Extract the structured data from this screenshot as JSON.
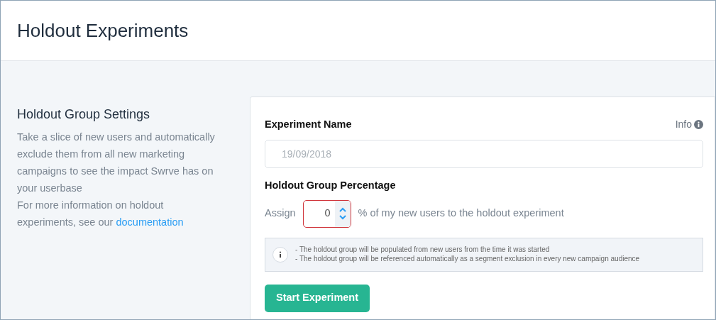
{
  "page": {
    "title": "Holdout Experiments"
  },
  "settings": {
    "heading": "Holdout Group Settings",
    "description": "Take a slice of new users and automatically exclude them from all new marketing campaigns to see the impact Swrve has on your userbase",
    "more_info": "For more information on holdout experiments, see our",
    "link": "documentation"
  },
  "form": {
    "name_label": "Experiment Name",
    "info_link": "Info",
    "name_field": {
      "placeholder": "19/09/2018"
    },
    "percentage_label": "Holdout Group Percentage",
    "assign_prefix": "Assign",
    "percentage_field": {
      "value": "0",
      "invalid": true
    },
    "assign_suffix": "% of my new users to the holdout experiment",
    "notes": [
      "- The holdout group will be populated from new users from the time it was started",
      "- The holdout group will be referenced automatically as a segment exclusion in every new campaign audience"
    ],
    "submit": "Start Experiment"
  }
}
